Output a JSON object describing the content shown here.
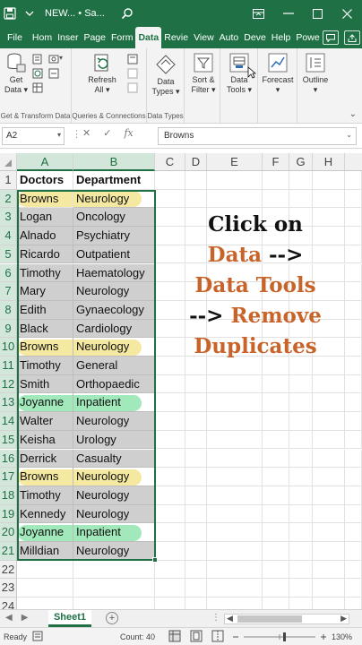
{
  "titlebar": {
    "title": "NEW... • Sa...",
    "autosave_icon": "save-icon",
    "search_icon": "search-icon",
    "colors": {
      "bar": "#1f7145"
    }
  },
  "tabs": {
    "items": [
      "File",
      "Hom",
      "Inser",
      "Page",
      "Form",
      "Data",
      "Revie",
      "View",
      "Auto",
      "Deve",
      "Help",
      "Powe"
    ],
    "active": "Data"
  },
  "ribbon": {
    "groups": {
      "get_transform": {
        "label": "Get & Transform Data",
        "get_data_top": "Get",
        "get_data_bottom": "Data"
      },
      "queries": {
        "label": "Queries & Connections",
        "refresh_top": "Refresh",
        "refresh_bottom": "All"
      },
      "data_types": {
        "label": "Data Types",
        "btn_top": "Data",
        "btn_bottom": "Types"
      },
      "sort_filter": {
        "btn_top": "Sort &",
        "btn_bottom": "Filter"
      },
      "data_tools": {
        "btn_top": "Data",
        "btn_bottom": "Tools"
      },
      "forecast": {
        "btn_top": "Forecast"
      },
      "outline": {
        "btn_top": "Outline"
      }
    }
  },
  "formula_bar": {
    "name_box": "A2",
    "cancel_symbol": "✕",
    "enter_symbol": "✓",
    "fx_symbol": "fx",
    "value": "Browns"
  },
  "grid": {
    "columns": [
      "A",
      "B",
      "C",
      "D",
      "E",
      "F",
      "G",
      "H"
    ],
    "header_row": {
      "row": "1",
      "a": "Doctors",
      "b": "Department"
    },
    "rows": [
      {
        "row": "2",
        "a": "Browns",
        "b": "Neurology",
        "hl": "yellow"
      },
      {
        "row": "3",
        "a": "Logan",
        "b": "Oncology"
      },
      {
        "row": "4",
        "a": "Alnado",
        "b": "Psychiatry"
      },
      {
        "row": "5",
        "a": "Ricardo",
        "b": "Outpatient"
      },
      {
        "row": "6",
        "a": "Timothy",
        "b": "Haematology"
      },
      {
        "row": "7",
        "a": "Mary",
        "b": "Neurology"
      },
      {
        "row": "8",
        "a": "Edith",
        "b": "Gynaecology"
      },
      {
        "row": "9",
        "a": "Black",
        "b": "Cardiology"
      },
      {
        "row": "10",
        "a": "Browns",
        "b": "Neurology",
        "hl": "yellow"
      },
      {
        "row": "11",
        "a": "Timothy",
        "b": "General"
      },
      {
        "row": "12",
        "a": "Smith",
        "b": "Orthopaedic"
      },
      {
        "row": "13",
        "a": "Joyanne",
        "b": "Inpatient",
        "hl": "green"
      },
      {
        "row": "14",
        "a": "Walter",
        "b": "Neurology"
      },
      {
        "row": "15",
        "a": "Keisha",
        "b": "Urology"
      },
      {
        "row": "16",
        "a": "Derrick",
        "b": "Casualty"
      },
      {
        "row": "17",
        "a": "Browns",
        "b": "Neurology",
        "hl": "yellow"
      },
      {
        "row": "18",
        "a": "Timothy",
        "b": "Neurology"
      },
      {
        "row": "19",
        "a": "Kennedy",
        "b": "Neurology"
      },
      {
        "row": "20",
        "a": "Joyanne",
        "b": "Inpatient",
        "hl": "green"
      },
      {
        "row": "21",
        "a": "Milldian",
        "b": "Neurology"
      }
    ],
    "empty_rows": [
      "22",
      "23",
      "24"
    ]
  },
  "callout": {
    "line1": "Click on",
    "line2_word": "Data",
    "line2_arrow": " -->",
    "line3": "Data Tools",
    "line4_arrow": "--> ",
    "line4_word": "Remove",
    "line5": "Duplicates",
    "colors": {
      "black": "#111111",
      "orange": "#c8642a"
    }
  },
  "sheets": {
    "active": "Sheet1",
    "add_symbol": "+"
  },
  "statusbar": {
    "ready": "Ready",
    "count": "Count: 40",
    "zoom": "130%"
  }
}
